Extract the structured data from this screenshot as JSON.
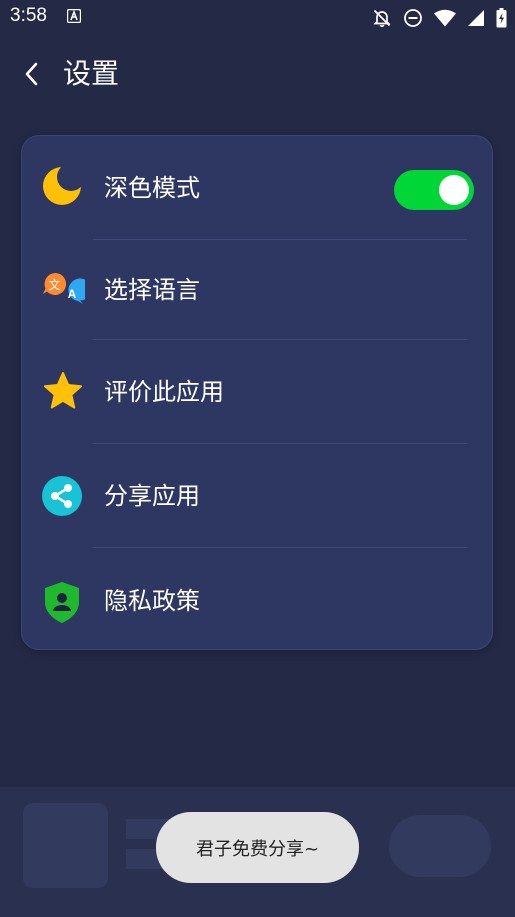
{
  "status_bar": {
    "time": "3:58",
    "icons": [
      "a-app-icon",
      "notifications-off-icon",
      "do-not-disturb-icon",
      "wifi-icon",
      "signal-icon",
      "battery-charging-icon"
    ]
  },
  "app_bar": {
    "back_icon": "chevron-left-icon",
    "title": "设置"
  },
  "settings": {
    "items": [
      {
        "icon": "moon-icon",
        "label": "深色模式",
        "toggle": true,
        "toggle_on": true
      },
      {
        "icon": "translate-icon",
        "label": "选择语言",
        "icon_text_1": "文",
        "icon_text_2": "A"
      },
      {
        "icon": "star-icon",
        "label": "评价此应用"
      },
      {
        "icon": "share-icon",
        "label": "分享应用"
      },
      {
        "icon": "shield-user-icon",
        "label": "隐私政策"
      }
    ]
  },
  "toast": {
    "text": "君子免费分享~"
  },
  "colors": {
    "background": "#242945",
    "card": "#2d3762",
    "toggle_on": "#00d636",
    "moon": "#ffc107",
    "star": "#ffc107",
    "share": "#17c3d4",
    "shield": "#1fb82e",
    "translate_orange": "#ff8a30",
    "translate_blue": "#2ea8f0",
    "toast": "#e3e3e3"
  }
}
